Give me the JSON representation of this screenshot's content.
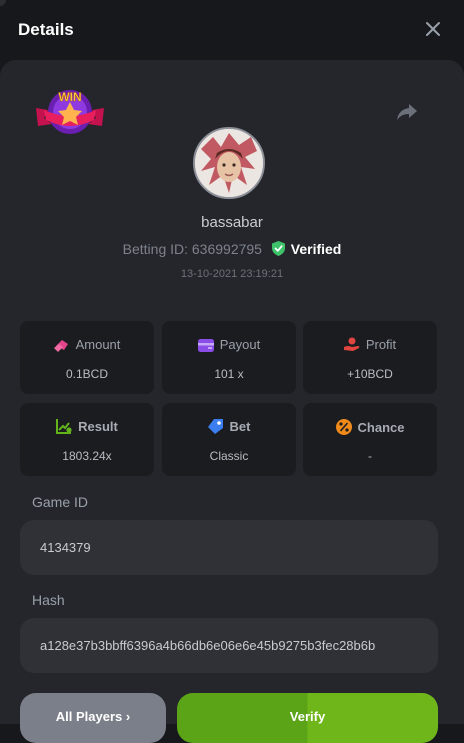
{
  "header": {
    "title": "Details"
  },
  "player": {
    "username": "bassabar",
    "betting_id_label": "Betting ID: 636992795",
    "verified_label": "Verified",
    "timestamp": "13-10-2021 23:19:21"
  },
  "badge": {
    "text": "WIN"
  },
  "stats": [
    {
      "label": "Amount",
      "value": "0.1BCD",
      "icon": "amount-icon",
      "color": "#e0458a"
    },
    {
      "label": "Payout",
      "value": "101 x",
      "icon": "payout-icon",
      "color": "#8a4de8"
    },
    {
      "label": "Profit",
      "value": "+10BCD",
      "icon": "profit-icon",
      "color": "#e0453f"
    },
    {
      "label": "Result",
      "value": "1803.24x",
      "icon": "result-icon",
      "color": "#63b31b"
    },
    {
      "label": "Bet",
      "value": "Classic",
      "icon": "bet-icon",
      "color": "#3b7ef0"
    },
    {
      "label": "Chance",
      "value": "-",
      "icon": "chance-icon",
      "color": "#f08a1a"
    }
  ],
  "game_id": {
    "label": "Game ID",
    "value": "4134379"
  },
  "hash": {
    "label": "Hash",
    "value": "a128e37b3bbff6396a4b66db6e06e6e45b9275b3fec28b6b"
  },
  "buttons": {
    "all_players": "All Players ›",
    "verify": "Verify"
  },
  "colors": {
    "accent_green": "#5ca417",
    "verified_green": "#3ec36b"
  }
}
